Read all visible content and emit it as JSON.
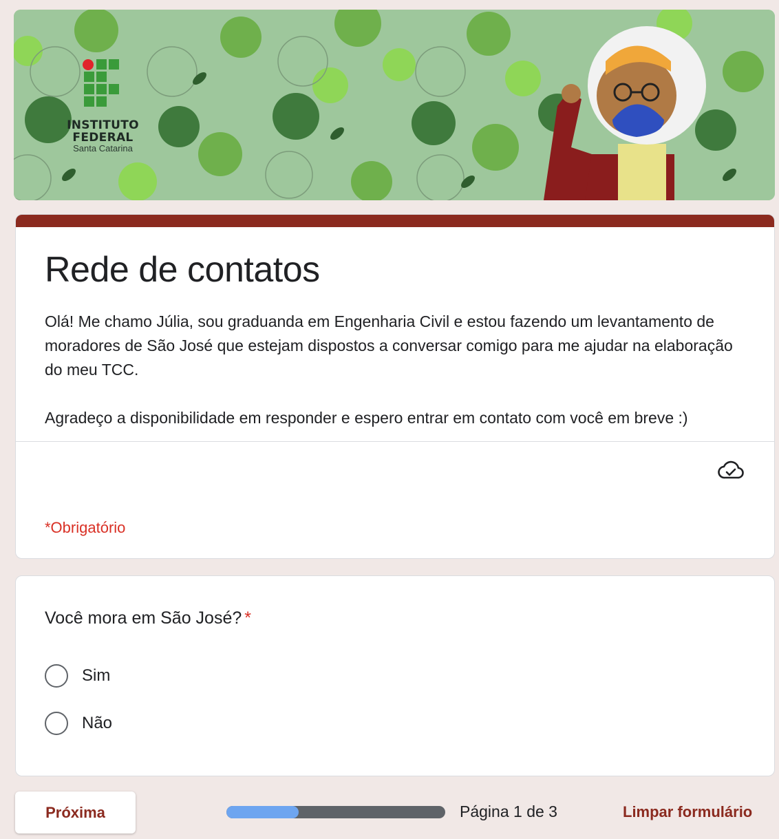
{
  "header": {
    "logo": {
      "line1": "INSTITUTO",
      "line2": "FEDERAL",
      "line3": "Santa Catarina"
    }
  },
  "form": {
    "title": "Rede de contatos",
    "description_p1": "Olá! Me chamo Júlia, sou graduanda em Engenharia Civil e estou fazendo um levantamento de moradores de São José que estejam dispostos a conversar comigo para me ajudar na elaboração do meu TCC.",
    "description_p2": "Agradeço a disponibilidade em responder e espero entrar em contato com você em breve :)",
    "required_note": "*Obrigatório",
    "cloud_icon": "cloud-check-icon"
  },
  "question": {
    "title": "Você mora em São José?",
    "required_mark": "*",
    "options": [
      {
        "label": "Sim",
        "selected": false
      },
      {
        "label": "Não",
        "selected": false
      }
    ]
  },
  "footer": {
    "next_label": "Próxima",
    "progress_fraction": 0.33,
    "page_indicator": "Página 1 de 3",
    "clear_label": "Limpar formulário"
  },
  "colors": {
    "accent": "#8b2a1f",
    "page_background": "#f1e8e6",
    "required": "#d93025",
    "progress_fill": "#6ea5f0",
    "progress_track": "#5f6368"
  }
}
